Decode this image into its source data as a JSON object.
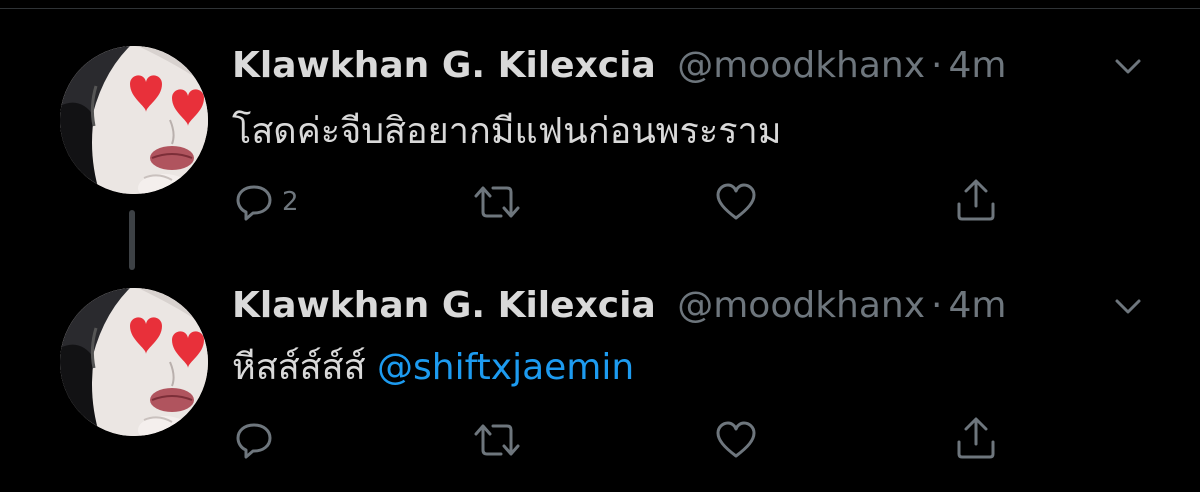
{
  "colors": {
    "background": "#000000",
    "text": "#d9d9d9",
    "secondary": "#6e767d",
    "link": "#1d9bf0",
    "thread_line": "#3d4145",
    "heart_eyes": "#e8303a"
  },
  "tweets": [
    {
      "display_name": "Klawkhan G. Kilexcia",
      "handle": "@moodkhanx",
      "separator": "·",
      "time": "4m",
      "text": "โสดค่ะจีบสิอยากมีแฟนก่อนพระราม",
      "reply_count": "2",
      "actions": [
        "reply-icon",
        "retweet-icon",
        "like-icon",
        "share-icon"
      ]
    },
    {
      "display_name": "Klawkhan G. Kilexcia",
      "handle": "@moodkhanx",
      "separator": "·",
      "time": "4m",
      "text": "หีสส์ส์ส์ส์",
      "mention": "@shiftxjaemin",
      "actions": [
        "reply-icon",
        "retweet-icon",
        "like-icon",
        "share-icon"
      ]
    }
  ]
}
